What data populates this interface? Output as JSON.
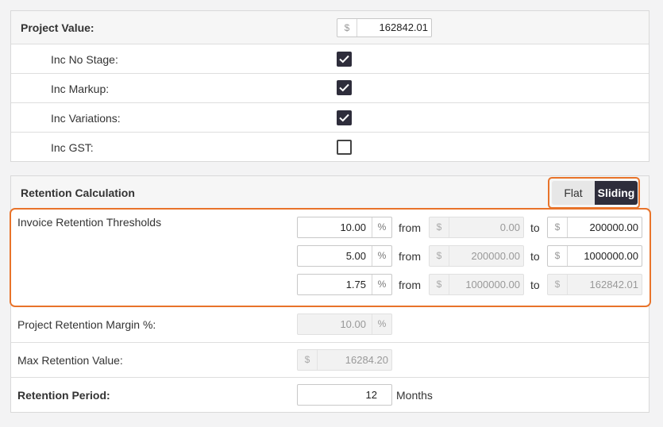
{
  "project_value": {
    "label": "Project Value:",
    "currency": "$",
    "value": "162842.01",
    "options": [
      {
        "label": "Inc No Stage:",
        "checked": true
      },
      {
        "label": "Inc Markup:",
        "checked": true
      },
      {
        "label": "Inc Variations:",
        "checked": true
      },
      {
        "label": "Inc GST:",
        "checked": false
      }
    ]
  },
  "retention": {
    "title": "Retention Calculation",
    "toggle": {
      "flat": "Flat",
      "sliding": "Sliding",
      "selected": "sliding"
    },
    "thresholds_label": "Invoice Retention Thresholds",
    "from_word": "from",
    "to_word": "to",
    "percent_sign": "%",
    "currency": "$",
    "thresholds": [
      {
        "percent": "10.00",
        "from": "0.00",
        "to": "200000.00"
      },
      {
        "percent": "5.00",
        "from": "200000.00",
        "to": "1000000.00"
      },
      {
        "percent": "1.75",
        "from": "1000000.00",
        "to": "162842.01"
      }
    ],
    "margin": {
      "label": "Project Retention Margin %:",
      "value": "10.00"
    },
    "max_value": {
      "label": "Max Retention Value:",
      "value": "16284.20"
    },
    "period": {
      "label": "Retention Period:",
      "value": "12",
      "unit": "Months"
    }
  },
  "colors": {
    "accent_orange": "#e8732a",
    "dark": "#2e2d3b"
  }
}
